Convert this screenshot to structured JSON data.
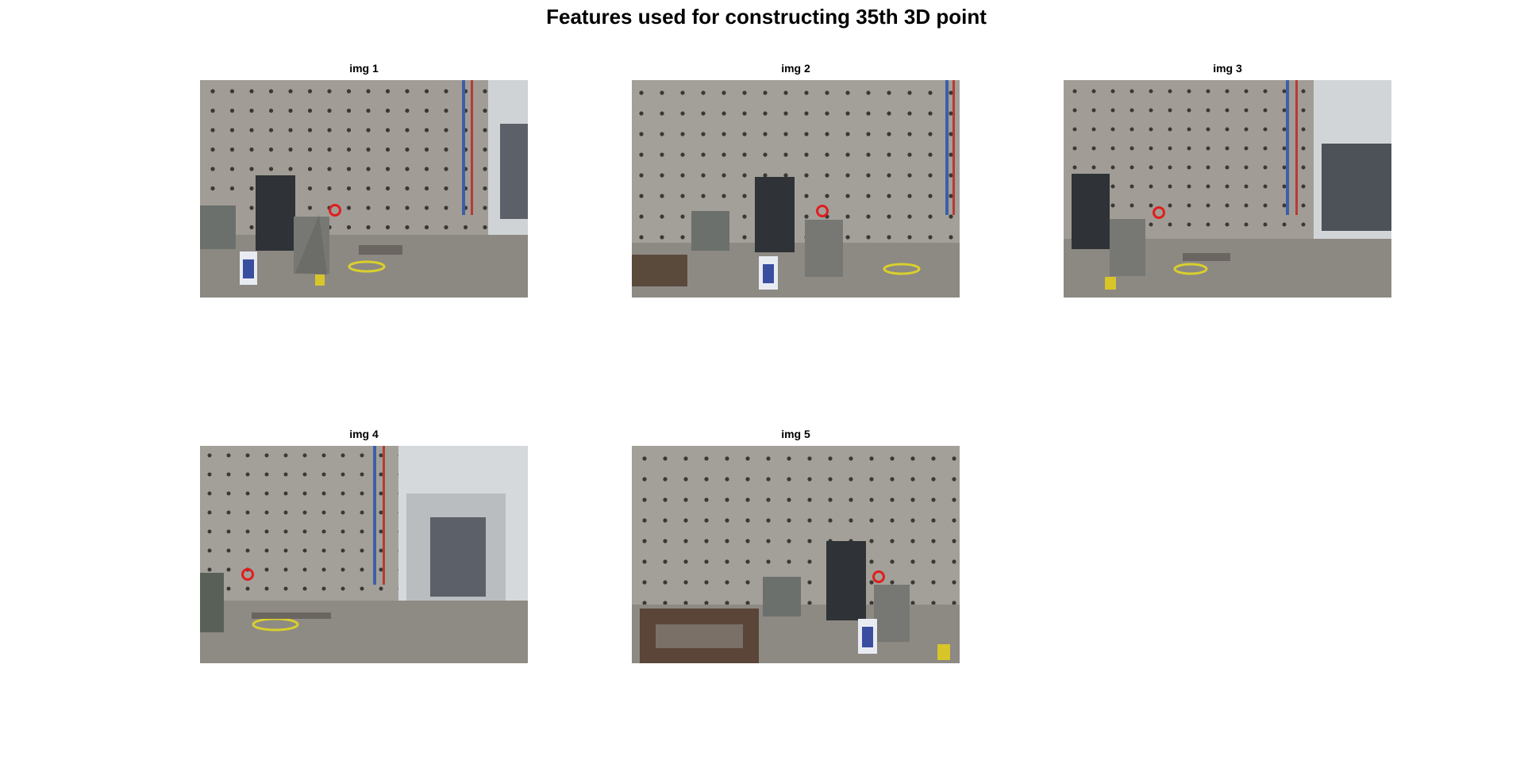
{
  "figure": {
    "title": "Features used for constructing 35th 3D point"
  },
  "panels": [
    {
      "title": "img 1"
    },
    {
      "title": "img 2"
    },
    {
      "title": "img 3"
    },
    {
      "title": "img 4"
    },
    {
      "title": "img 5"
    }
  ],
  "marker": {
    "color": "#e01e1e"
  }
}
